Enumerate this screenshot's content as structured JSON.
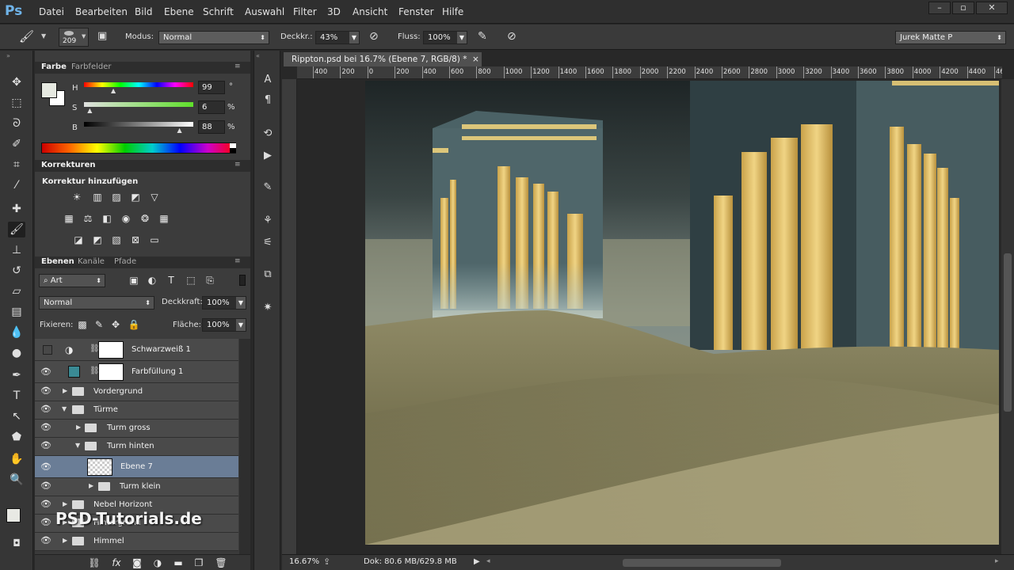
{
  "app": {
    "logo": "Ps"
  },
  "menu": [
    "Datei",
    "Bearbeiten",
    "Bild",
    "Ebene",
    "Schrift",
    "Auswahl",
    "Filter",
    "3D",
    "Ansicht",
    "Fenster",
    "Hilfe"
  ],
  "options": {
    "brush_size": "209",
    "mode_label": "Modus:",
    "mode_value": "Normal",
    "opacity_label": "Deckkr.:",
    "opacity_value": "43%",
    "flow_label": "Fluss:",
    "flow_value": "100%",
    "workspace": "Jurek Matte P"
  },
  "color_panel": {
    "tabs": [
      "Farbe",
      "Farbfelder"
    ],
    "h_label": "H",
    "h_value": "99",
    "h_unit": "°",
    "s_label": "S",
    "s_value": "6",
    "s_unit": "%",
    "b_label": "B",
    "b_value": "88",
    "b_unit": "%",
    "h_fraction": 0.275,
    "s_fraction": 0.06,
    "b_fraction": 0.88
  },
  "adjustments_panel": {
    "tab": "Korrekturen",
    "title": "Korrektur hinzufügen"
  },
  "layers_panel": {
    "tabs": [
      "Ebenen",
      "Kanäle",
      "Pfade"
    ],
    "filter_kind": "Art",
    "blend_mode": "Normal",
    "opacity_label": "Deckkraft:",
    "opacity_value": "100%",
    "lock_label": "Fixieren:",
    "fill_label": "Fläche:",
    "fill_value": "100%",
    "layers": [
      {
        "name": "Schwarzweiß 1",
        "type": "adjustment"
      },
      {
        "name": "Farbfüllung 1",
        "type": "fill"
      },
      {
        "name": "Vordergrund",
        "type": "group"
      },
      {
        "name": "Türme",
        "type": "group-open"
      },
      {
        "name": "Turm gross",
        "type": "group"
      },
      {
        "name": "Turm hinten",
        "type": "group-open"
      },
      {
        "name": "Ebene 7",
        "type": "layer",
        "selected": true
      },
      {
        "name": "Turm klein",
        "type": "group"
      },
      {
        "name": "Nebel Horizont",
        "type": "group"
      },
      {
        "name": "Hintergrund",
        "type": "group"
      },
      {
        "name": "Himmel",
        "type": "group"
      }
    ]
  },
  "document": {
    "tab_title": "Rippton.psd bei 16.7% (Ebene 7, RGB/8) *",
    "ruler_labels": [
      "400",
      "200",
      "0",
      "200",
      "400",
      "600",
      "800",
      "1000",
      "1200",
      "1400",
      "1600",
      "1800",
      "2000",
      "2200",
      "2400",
      "2600",
      "2800",
      "3000",
      "3200",
      "3400",
      "3600",
      "3800",
      "4000",
      "4200",
      "4400",
      "4600"
    ],
    "zoom": "16.67%",
    "doc_size": "Dok: 80.6 MB/629.8 MB"
  },
  "watermark": "PSD-Tutorials.de",
  "colors": {
    "selected_layer": "#6a7d96",
    "fill_swatch": "#3a8a94"
  }
}
